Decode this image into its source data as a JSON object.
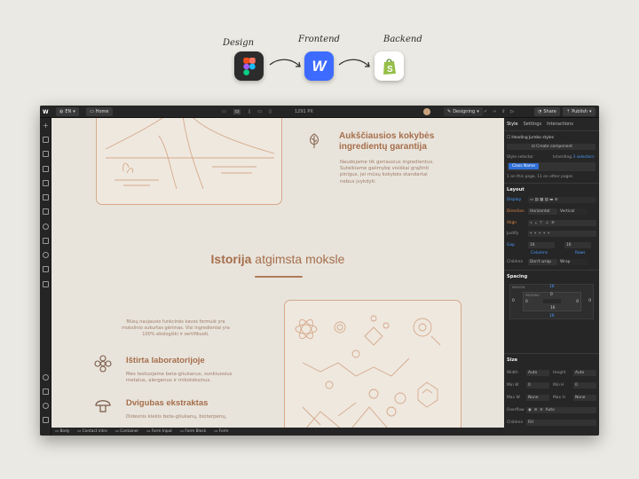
{
  "header": {
    "design_label": "Design",
    "frontend_label": "Frontend",
    "backend_label": "Backend",
    "webflow_letter": "W"
  },
  "topbar": {
    "lang": "EN",
    "page": "Home",
    "width": "1291 PX",
    "mode": "Designing",
    "share": "Share",
    "publish": "Publish"
  },
  "canvas": {
    "quality_title_line1": "Aukščiausios kokybės",
    "quality_title_line2": "ingredientų garantija",
    "quality_text": [
      "Naudojame tik geriausius ingredientus.",
      "Sutelkiame galimybę visiškai grąžinti",
      "pinigus, jei mūsų kokybės standartai",
      "nebus įvykdyti."
    ],
    "history_bold": "Istorija",
    "history_rest": " atgimsta moksle",
    "intro_text": [
      "Mūsų naujausio funkcinės kavos formulė yra",
      "mokslinio sukurtas gėrimas. Visi ingredientai yra",
      "100% ekologiški ir sertifikuoti."
    ],
    "lab_title": "Ištirta laboratorijoje",
    "lab_text": [
      "Mes testuojame beta-gliukanus, sunkiuosius",
      "metalus, alergenus ir mikotoksinus."
    ],
    "double_title": "Dvigubas ekstraktas",
    "double_text": "Didesnis kiekis beta-gliukanų, bioterpenų,"
  },
  "bottombar": [
    "Body",
    "Contact intro",
    "Container",
    "Form Input",
    "Form Block",
    "Form"
  ],
  "panel": {
    "tabs": [
      "Style",
      "Settings",
      "Interactions"
    ],
    "heading_styles": "Heading Jumbo styles",
    "create_component": "Create component",
    "style_selector": "Style selector",
    "inheriting": "Inheriting",
    "inheriting_count": "3 selectors",
    "class_name": "Class Name",
    "on_page": "1 on this page, 11 on other pages",
    "layout": "Layout",
    "display": "Display",
    "direction": "Direction",
    "horizontal": "Horizontal",
    "vertical": "Vertical",
    "align": "Align",
    "justify": "Justify",
    "gap": "Gap",
    "gap_v1": "16",
    "gap_v2": "16",
    "columns": "Columns",
    "rows": "Rows",
    "children": "Children",
    "dont_wrap": "Don't wrap",
    "wrap": "Wrap",
    "spacing": "Spacing",
    "margin": "MARGIN",
    "padding": "PADDING",
    "spacing_values": [
      "16",
      "16",
      "0",
      "0",
      "0",
      "0",
      "0",
      "16"
    ],
    "size": "Size",
    "width": "Width",
    "height": "Height",
    "auto": "Auto",
    "min_w": "Min W",
    "min_h": "Min H",
    "max_w": "Max W",
    "max_h": "Max H",
    "zero": "0",
    "none": "None",
    "overflow": "Overflow",
    "children2": "Children",
    "fill": "Fill",
    "accent": "#4a9aff"
  }
}
